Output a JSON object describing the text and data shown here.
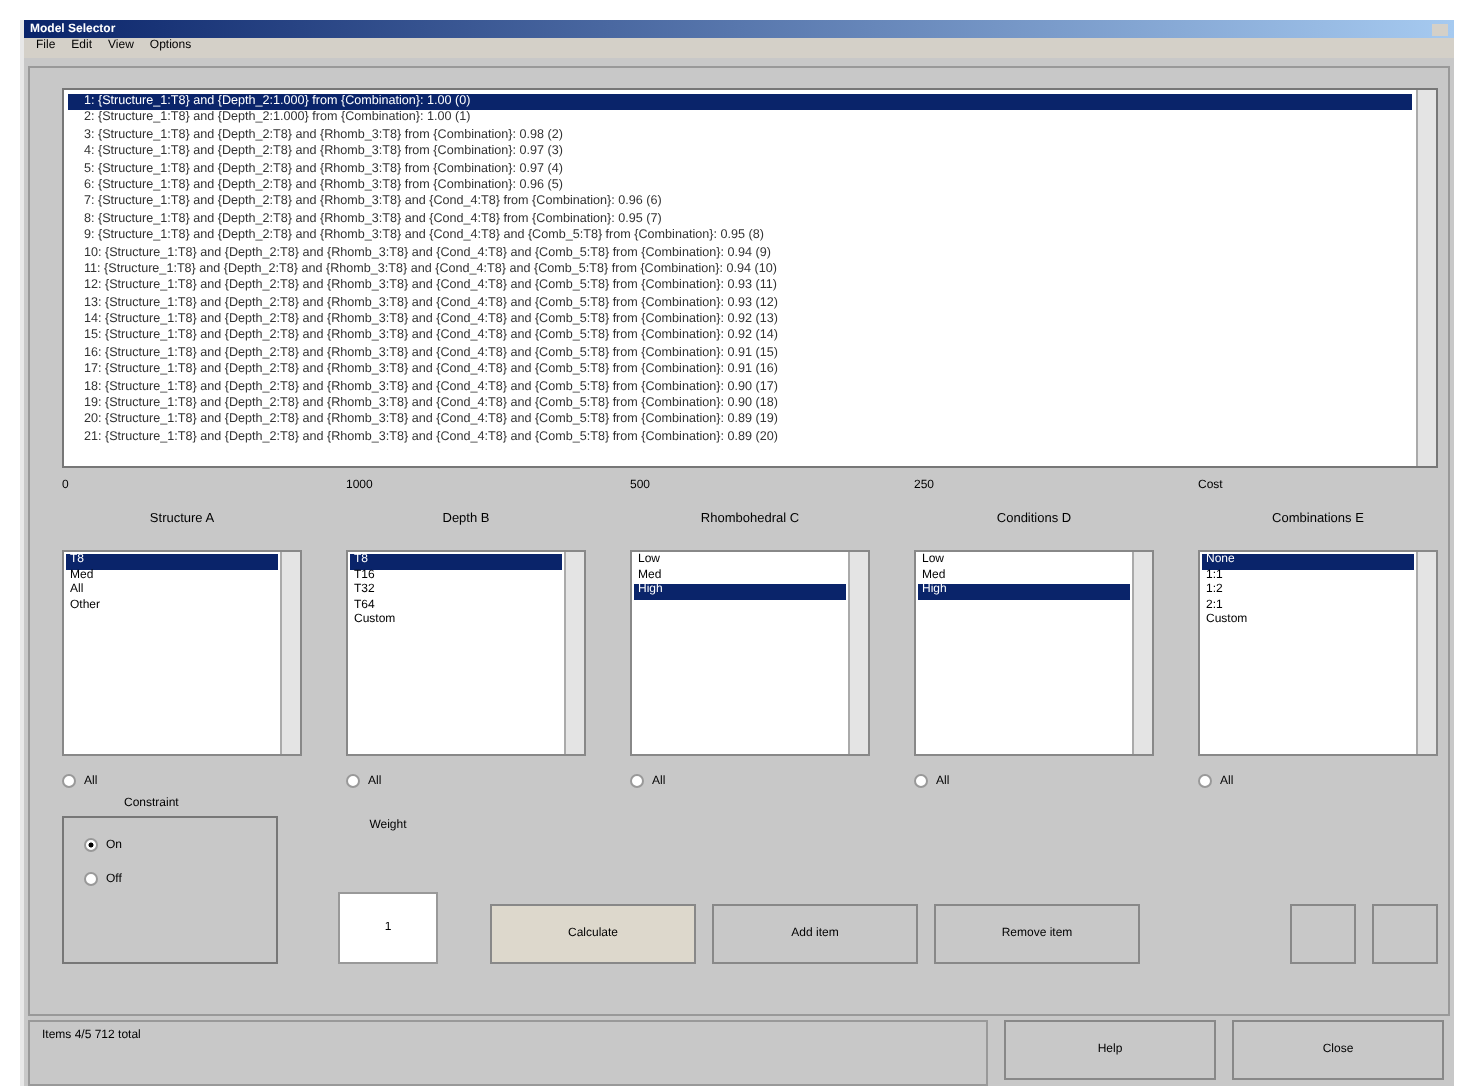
{
  "window": {
    "title": "Model Selector"
  },
  "menu": [
    "File",
    "Edit",
    "View",
    "Options"
  ],
  "results": [
    {
      "text": "1: {Structure_1:T8} and {Depth_2:1.000} from {Combination}: 1.00 (0)",
      "selected": true
    },
    {
      "text": "2: {Structure_1:T8} and {Depth_2:1.000} from {Combination}: 1.00 (1)",
      "selected": false
    },
    {
      "text": "3: {Structure_1:T8} and {Depth_2:T8} and {Rhomb_3:T8} from {Combination}: 0.98 (2)",
      "selected": false
    },
    {
      "text": "4: {Structure_1:T8} and {Depth_2:T8} and {Rhomb_3:T8} from {Combination}: 0.97 (3)",
      "selected": false
    },
    {
      "text": "5: {Structure_1:T8} and {Depth_2:T8} and {Rhomb_3:T8} from {Combination}: 0.97 (4)",
      "selected": false
    },
    {
      "text": "6: {Structure_1:T8} and {Depth_2:T8} and {Rhomb_3:T8} from {Combination}: 0.96 (5)",
      "selected": false
    },
    {
      "text": "7: {Structure_1:T8} and {Depth_2:T8} and {Rhomb_3:T8} and {Cond_4:T8} from {Combination}: 0.96 (6)",
      "selected": false
    },
    {
      "text": "8: {Structure_1:T8} and {Depth_2:T8} and {Rhomb_3:T8} and {Cond_4:T8} from {Combination}: 0.95 (7)",
      "selected": false
    },
    {
      "text": "9: {Structure_1:T8} and {Depth_2:T8} and {Rhomb_3:T8} and {Cond_4:T8} and {Comb_5:T8} from {Combination}: 0.95 (8)",
      "selected": false
    },
    {
      "text": "10: {Structure_1:T8} and {Depth_2:T8} and {Rhomb_3:T8} and {Cond_4:T8} and {Comb_5:T8} from {Combination}: 0.94 (9)",
      "selected": false
    },
    {
      "text": "11: {Structure_1:T8} and {Depth_2:T8} and {Rhomb_3:T8} and {Cond_4:T8} and {Comb_5:T8} from {Combination}: 0.94 (10)",
      "selected": false
    },
    {
      "text": "12: {Structure_1:T8} and {Depth_2:T8} and {Rhomb_3:T8} and {Cond_4:T8} and {Comb_5:T8} from {Combination}: 0.93 (11)",
      "selected": false
    },
    {
      "text": "13: {Structure_1:T8} and {Depth_2:T8} and {Rhomb_3:T8} and {Cond_4:T8} and {Comb_5:T8} from {Combination}: 0.93 (12)",
      "selected": false
    },
    {
      "text": "14: {Structure_1:T8} and {Depth_2:T8} and {Rhomb_3:T8} and {Cond_4:T8} and {Comb_5:T8} from {Combination}: 0.92 (13)",
      "selected": false
    },
    {
      "text": "15: {Structure_1:T8} and {Depth_2:T8} and {Rhomb_3:T8} and {Cond_4:T8} and {Comb_5:T8} from {Combination}: 0.92 (14)",
      "selected": false
    },
    {
      "text": "16: {Structure_1:T8} and {Depth_2:T8} and {Rhomb_3:T8} and {Cond_4:T8} and {Comb_5:T8} from {Combination}: 0.91 (15)",
      "selected": false
    },
    {
      "text": "17: {Structure_1:T8} and {Depth_2:T8} and {Rhomb_3:T8} and {Cond_4:T8} and {Comb_5:T8} from {Combination}: 0.91 (16)",
      "selected": false
    },
    {
      "text": "18: {Structure_1:T8} and {Depth_2:T8} and {Rhomb_3:T8} and {Cond_4:T8} and {Comb_5:T8} from {Combination}: 0.90 (17)",
      "selected": false
    },
    {
      "text": "19: {Structure_1:T8} and {Depth_2:T8} and {Rhomb_3:T8} and {Cond_4:T8} and {Comb_5:T8} from {Combination}: 0.90 (18)",
      "selected": false
    },
    {
      "text": "20: {Structure_1:T8} and {Depth_2:T8} and {Rhomb_3:T8} and {Cond_4:T8} and {Comb_5:T8} from {Combination}: 0.89 (19)",
      "selected": false
    },
    {
      "text": "21: {Structure_1:T8} and {Depth_2:T8} and {Rhomb_3:T8} and {Cond_4:T8} and {Comb_5:T8} from {Combination}: 0.89 (20)",
      "selected": false
    }
  ],
  "groups": [
    {
      "value": "0",
      "title": "Structure A",
      "items": [
        {
          "label": "T8",
          "selected": true
        },
        {
          "label": "Med",
          "selected": false
        },
        {
          "label": "All",
          "selected": false
        },
        {
          "label": "Other",
          "selected": false
        }
      ],
      "all": {
        "label": "All",
        "checked": false
      }
    },
    {
      "value": "1000",
      "title": "Depth B",
      "items": [
        {
          "label": "T8",
          "selected": true
        },
        {
          "label": "T16",
          "selected": false
        },
        {
          "label": "T32",
          "selected": false
        },
        {
          "label": "T64",
          "selected": false
        },
        {
          "label": "Custom",
          "selected": false
        }
      ],
      "all": {
        "label": "All",
        "checked": false
      }
    },
    {
      "value": "500",
      "title": "Rhombohedral C",
      "items": [
        {
          "label": "Low",
          "selected": false
        },
        {
          "label": "Med",
          "selected": false
        },
        {
          "label": "High",
          "selected": true
        }
      ],
      "all": {
        "label": "All",
        "checked": false
      }
    },
    {
      "value": "250",
      "title": "Conditions D",
      "items": [
        {
          "label": "Low",
          "selected": false
        },
        {
          "label": "Med",
          "selected": false
        },
        {
          "label": "High",
          "selected": true
        }
      ],
      "all": {
        "label": "All",
        "checked": false
      }
    },
    {
      "value": "Cost",
      "title": "Combinations E",
      "items": [
        {
          "label": "None",
          "selected": true
        },
        {
          "label": "1:1",
          "selected": false
        },
        {
          "label": "1:2",
          "selected": false
        },
        {
          "label": "2:1",
          "selected": false
        },
        {
          "label": "Custom",
          "selected": false
        }
      ],
      "all": {
        "label": "All",
        "checked": false
      }
    }
  ],
  "mode": {
    "title": "Constraint",
    "options": [
      {
        "label": "On",
        "selected": true
      },
      {
        "label": "Off",
        "selected": false
      }
    ]
  },
  "weight": {
    "label": "Weight",
    "value": "1"
  },
  "actions": [
    {
      "label": "Calculate",
      "highlighted": true
    },
    {
      "label": "Add item",
      "highlighted": false
    },
    {
      "label": "Remove item",
      "highlighted": false
    }
  ],
  "status": "Items 4/5 712 total",
  "footer_buttons": [
    "Help",
    "Close"
  ]
}
